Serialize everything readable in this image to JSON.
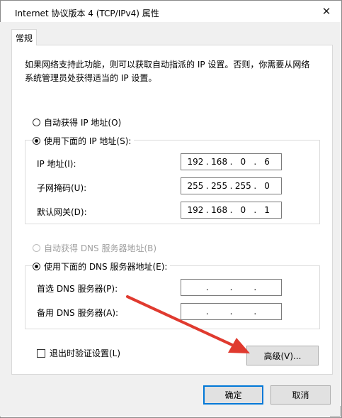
{
  "window": {
    "title": "Internet 协议版本 4 (TCP/IPv4) 属性",
    "close_glyph": "✕"
  },
  "tabs": [
    {
      "label": "常规"
    }
  ],
  "description": "如果网络支持此功能，则可以获取自动指派的 IP 设置。否则，你需要从网络系统管理员处获得适当的 IP 设置。",
  "ip_mode": {
    "auto_label": "自动获得 IP 地址(O)",
    "manual_label": "使用下面的 IP 地址(S):",
    "selected": "manual"
  },
  "ip_fields": [
    {
      "label": "IP 地址(I):",
      "octets": [
        "192",
        "168",
        "0",
        "6"
      ]
    },
    {
      "label": "子网掩码(U):",
      "octets": [
        "255",
        "255",
        "255",
        "0"
      ]
    },
    {
      "label": "默认网关(D):",
      "octets": [
        "192",
        "168",
        "0",
        "1"
      ]
    }
  ],
  "dns_mode": {
    "auto_label": "自动获得 DNS 服务器地址(B)",
    "manual_label": "使用下面的 DNS 服务器地址(E):",
    "selected": "manual"
  },
  "dns_fields": [
    {
      "label": "首选 DNS 服务器(P):",
      "octets": [
        "",
        "",
        "",
        ""
      ]
    },
    {
      "label": "备用 DNS 服务器(A):",
      "octets": [
        "",
        "",
        "",
        ""
      ]
    }
  ],
  "validate_checkbox": {
    "label": "退出时验证设置(L)",
    "checked": false
  },
  "buttons": {
    "advanced": "高级(V)...",
    "ok": "确定",
    "cancel": "取消"
  },
  "colors": {
    "arrow": "#e03a2f",
    "default_button_border": "#0078d7"
  }
}
